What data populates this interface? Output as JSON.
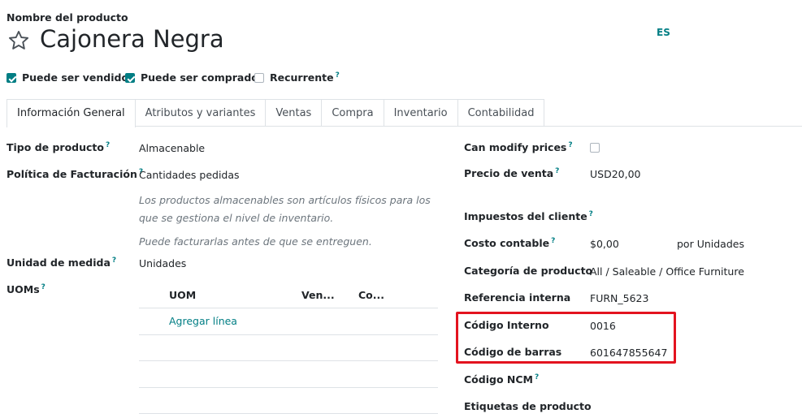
{
  "header": {
    "field_label": "Nombre del producto",
    "product_name": "Cajonera Negra",
    "lang": "ES"
  },
  "options": {
    "sale_ok": {
      "label": "Puede ser vendido",
      "checked": true
    },
    "purchase_ok": {
      "label": "Puede ser comprado",
      "checked": true
    },
    "recurring": {
      "label": "Recurrente",
      "checked": false
    }
  },
  "help_mark": "?",
  "tabs": [
    {
      "label": "Información General",
      "active": true
    },
    {
      "label": "Atributos y variantes"
    },
    {
      "label": "Ventas"
    },
    {
      "label": "Compra"
    },
    {
      "label": "Inventario"
    },
    {
      "label": "Contabilidad"
    }
  ],
  "left": {
    "product_type": {
      "label": "Tipo de producto",
      "value": "Almacenable"
    },
    "invoice_policy": {
      "label": "Política de Facturación",
      "value": "Cantidades pedidas"
    },
    "hint1": "Los productos almacenables son artículos físicos para los que se gestiona el nivel de inventario.",
    "hint2": "Puede facturarlas antes de que se entreguen.",
    "uom": {
      "label": "Unidad de medida",
      "value": "Unidades"
    },
    "uoms": {
      "label": "UOMs",
      "columns": [
        "UOM",
        "Ven...",
        "Co..."
      ],
      "add_line": "Agregar línea"
    }
  },
  "right": {
    "can_modify_prices": {
      "label": "Can modify prices",
      "checked": false
    },
    "list_price": {
      "label": "Precio de venta",
      "value": "USD20,00"
    },
    "taxes": {
      "label": "Impuestos del cliente"
    },
    "cost": {
      "label": "Costo contable",
      "value": "$0,00",
      "suffix": "por Unidades"
    },
    "category": {
      "label": "Categoría de producto",
      "value": "All / Saleable / Office Furniture"
    },
    "default_code": {
      "label": "Referencia interna",
      "value": "FURN_5623"
    },
    "internal_code": {
      "label": "Código Interno",
      "value": "0016"
    },
    "barcode": {
      "label": "Código de barras",
      "value": "601647855647"
    },
    "ncm": {
      "label": "Código NCM"
    },
    "tags": {
      "label": "Etiquetas de producto"
    }
  },
  "colors": {
    "accent": "#017e84",
    "highlight": "#e3131f"
  }
}
